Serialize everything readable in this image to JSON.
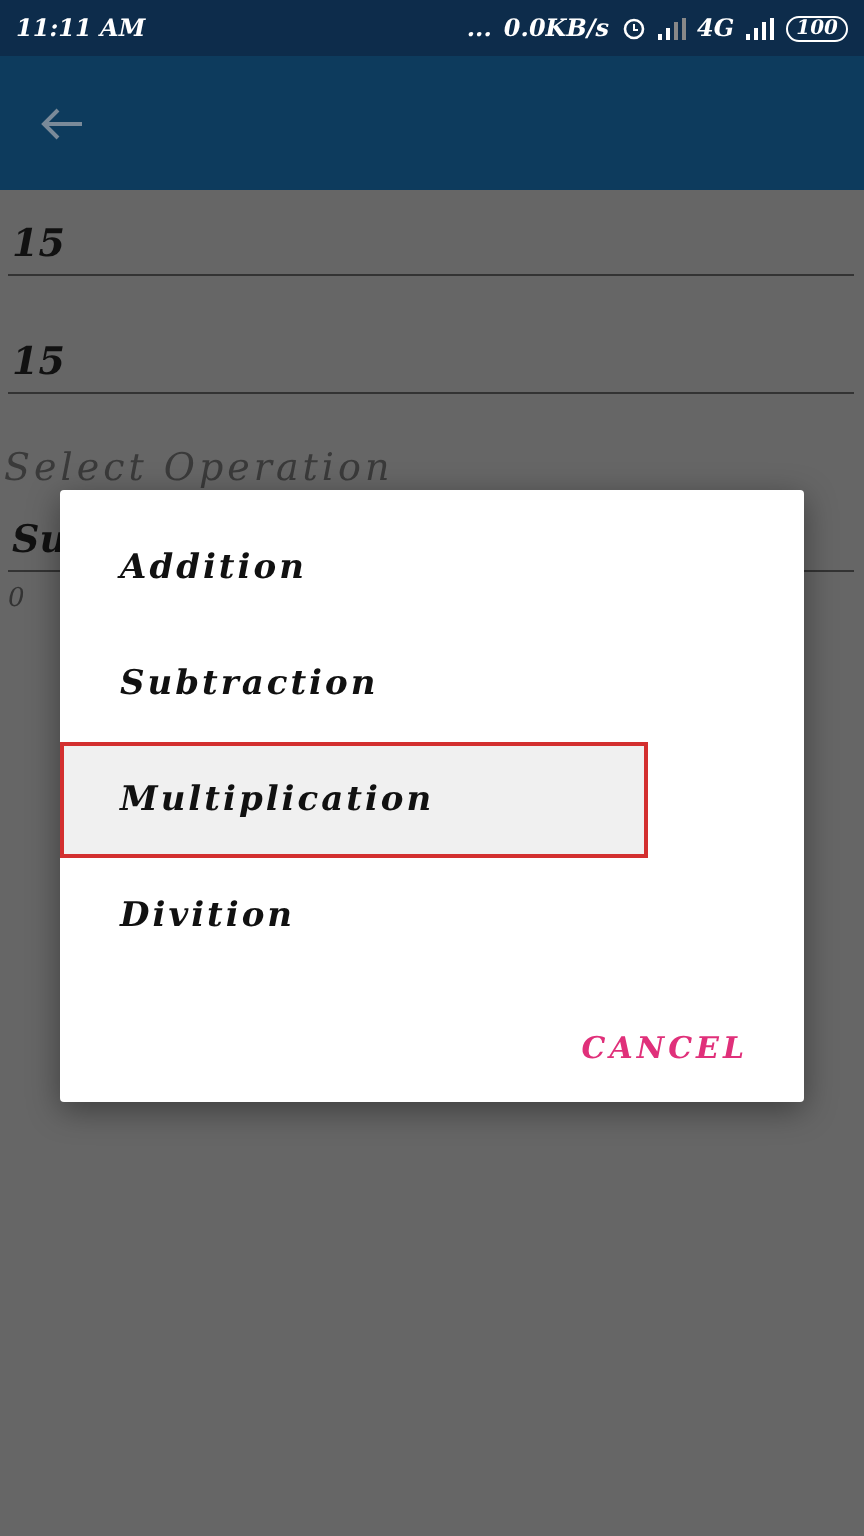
{
  "status_bar": {
    "time": "11:11 AM",
    "more": "...",
    "speed": "0.0KB/s",
    "network": "4G",
    "battery": "100"
  },
  "form": {
    "first_number": "15",
    "second_number": "15",
    "operation_label": "Select Operation",
    "operation_value": "Su",
    "result": "0"
  },
  "dialog": {
    "options": [
      {
        "label": "Addition",
        "selected": false
      },
      {
        "label": "Subtraction",
        "selected": false
      },
      {
        "label": "Multiplication",
        "selected": true
      },
      {
        "label": "Divition",
        "selected": false
      }
    ],
    "cancel": "CANCEL"
  }
}
